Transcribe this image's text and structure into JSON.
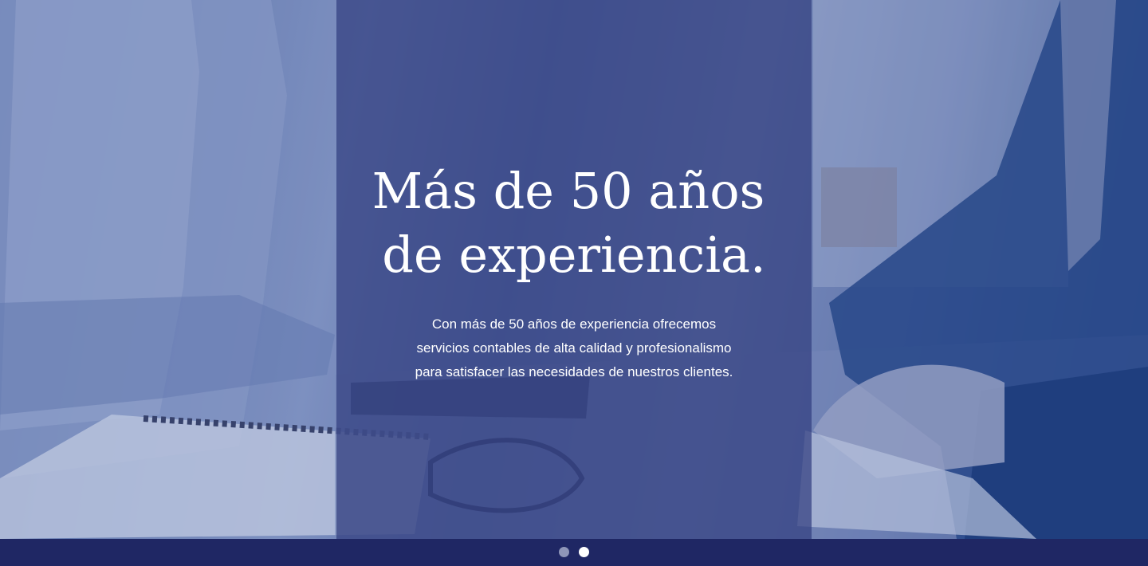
{
  "hero": {
    "headline_line1": "Más de 50 años",
    "headline_line2": "de experiencia.",
    "body_line1": "Con más de 50 años de experiencia ofrecemos",
    "body_line2": "servicios contables de alta calidad y profesionalismo",
    "body_line3": "para satisfacer las necesidades de nuestros clientes.",
    "background_image": "business-meeting-photo",
    "overlay_color": "#323e80"
  },
  "carousel": {
    "slide_count": 2,
    "active_slide": 2,
    "dot_color": "#8f96b8",
    "active_dot_color": "#ffffff",
    "bar_color": "#1f2764"
  }
}
